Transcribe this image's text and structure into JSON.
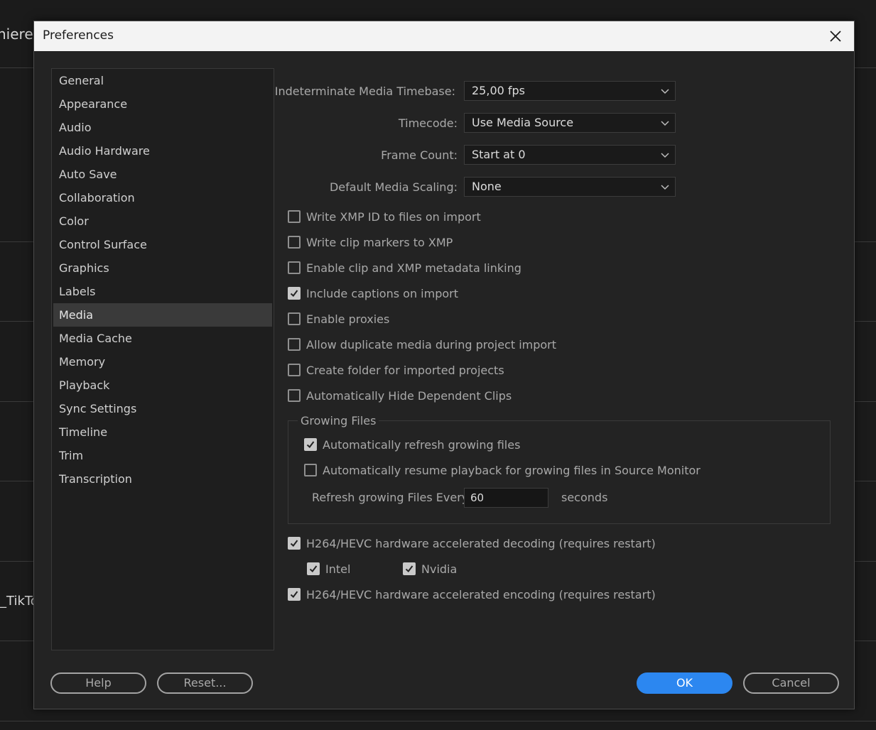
{
  "background": {
    "partial_title": "niere",
    "partial_tiktok": "_TikTok"
  },
  "dialog": {
    "title": "Preferences",
    "close_icon": "close-icon"
  },
  "sidebar": {
    "items": [
      {
        "label": "General"
      },
      {
        "label": "Appearance"
      },
      {
        "label": "Audio"
      },
      {
        "label": "Audio Hardware"
      },
      {
        "label": "Auto Save"
      },
      {
        "label": "Collaboration"
      },
      {
        "label": "Color"
      },
      {
        "label": "Control Surface"
      },
      {
        "label": "Graphics"
      },
      {
        "label": "Labels"
      },
      {
        "label": "Media"
      },
      {
        "label": "Media Cache"
      },
      {
        "label": "Memory"
      },
      {
        "label": "Playback"
      },
      {
        "label": "Sync Settings"
      },
      {
        "label": "Timeline"
      },
      {
        "label": "Trim"
      },
      {
        "label": "Transcription"
      }
    ],
    "selected": "Media"
  },
  "media": {
    "timebase": {
      "label": "Indeterminate Media Timebase:",
      "value": "25,00 fps"
    },
    "timecode": {
      "label": "Timecode:",
      "value": "Use Media Source"
    },
    "frame_count": {
      "label": "Frame Count:",
      "value": "Start at 0"
    },
    "scaling": {
      "label": "Default Media Scaling:",
      "value": "None"
    },
    "checkboxes": [
      {
        "label": "Write XMP ID to files on import",
        "checked": false
      },
      {
        "label": "Write clip markers to XMP",
        "checked": false
      },
      {
        "label": "Enable clip and XMP metadata linking",
        "checked": false
      },
      {
        "label": "Include captions on import",
        "checked": true
      },
      {
        "label": "Enable proxies",
        "checked": false
      },
      {
        "label": "Allow duplicate media during project import",
        "checked": false
      },
      {
        "label": "Create folder for imported projects",
        "checked": false
      },
      {
        "label": "Automatically Hide Dependent Clips",
        "checked": false
      }
    ],
    "growing_files": {
      "title": "Growing Files",
      "auto_refresh": {
        "label": "Automatically refresh growing files",
        "checked": true
      },
      "auto_resume": {
        "label": "Automatically resume playback for growing files in Source Monitor",
        "checked": false
      },
      "refresh_label": "Refresh growing Files Every",
      "refresh_value": "60",
      "refresh_unit": "seconds"
    },
    "hw_decode": {
      "label": "H264/HEVC hardware accelerated decoding (requires restart)",
      "checked": true
    },
    "intel": {
      "label": "Intel",
      "checked": true
    },
    "nvidia": {
      "label": "Nvidia",
      "checked": true
    },
    "hw_encode": {
      "label": "H264/HEVC hardware accelerated encoding (requires restart)",
      "checked": true
    }
  },
  "buttons": {
    "help": "Help",
    "reset": "Reset...",
    "ok": "OK",
    "cancel": "Cancel"
  },
  "colors": {
    "accent": "#2c87f0",
    "dialog_bg": "#232323",
    "titlebar_bg": "#f3f3f3"
  }
}
